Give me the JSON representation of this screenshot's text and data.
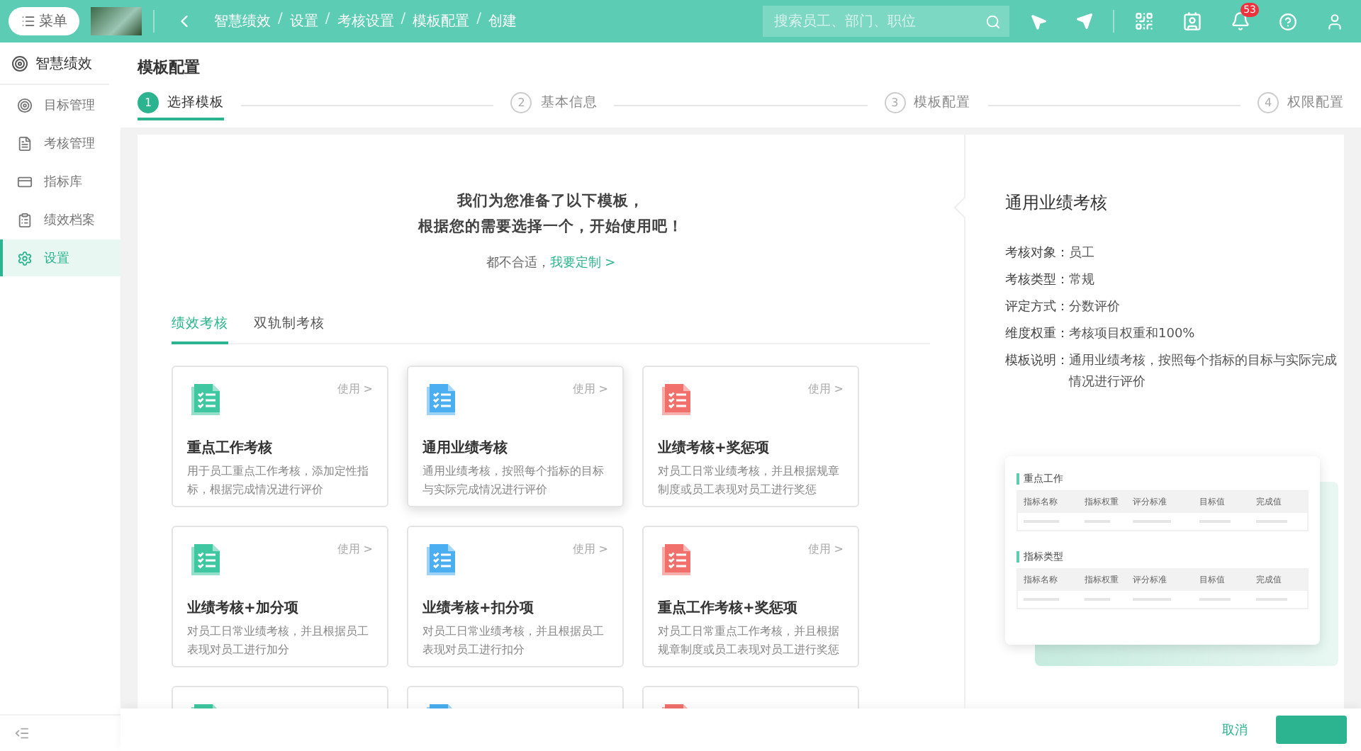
{
  "topbar": {
    "menu_button": "菜单",
    "breadcrumbs": [
      "智慧绩效",
      "设置",
      "考核设置",
      "模板配置",
      "创建"
    ],
    "breadcrumb_separator": "/",
    "search": {
      "placeholder": "搜索员工、部门、职位"
    },
    "notification_count": "53"
  },
  "sidebar": {
    "title": "智慧绩效",
    "items": [
      {
        "label": "目标管理",
        "kind": "target",
        "selected": false
      },
      {
        "label": "考核管理",
        "kind": "doc",
        "selected": false
      },
      {
        "label": "指标库",
        "kind": "card",
        "selected": false
      },
      {
        "label": "绩效档案",
        "kind": "clipboard",
        "selected": false
      },
      {
        "label": "设置",
        "kind": "gear",
        "selected": true
      }
    ]
  },
  "page_title": "模板配置",
  "steps": [
    {
      "number": "1",
      "label": "选择模板",
      "selected": true
    },
    {
      "number": "2",
      "label": "基本信息",
      "selected": false
    },
    {
      "number": "3",
      "label": "模板配置",
      "selected": false
    },
    {
      "number": "4",
      "label": "权限配置",
      "selected": false
    }
  ],
  "intro": [
    "我们为您准备了以下模板，",
    "根据您的需要选择一个，开始使用吧！"
  ],
  "custom_hint": {
    "text": "都不合适，",
    "link": "我要定制 >"
  },
  "tabs": [
    {
      "label": "绩效考核",
      "selected": true
    },
    {
      "label": "双轨制考核",
      "selected": false
    }
  ],
  "cards": [
    {
      "title": "重点工作考核",
      "description": "用于员工重点工作考核，添加定性指标，根据完成情况进行评价",
      "action": "使用 >",
      "color": "#3ec7a0",
      "selected": false
    },
    {
      "title": "通用业绩考核",
      "description": "通用业绩考核，按照每个指标的目标与实际完成情况进行评价",
      "action": "使用 >",
      "color": "#4aaef0",
      "selected": true
    },
    {
      "title": "业绩考核+奖惩项",
      "description": "对员工日常业绩考核，并且根据规章制度或员工表现对员工进行奖惩",
      "action": "使用 >",
      "color": "#f2706c",
      "selected": false
    },
    {
      "title": "业绩考核+加分项",
      "description": "对员工日常业绩考核，并且根据员工表现对员工进行加分",
      "action": "使用 >",
      "color": "#3ec7a0",
      "selected": false
    },
    {
      "title": "业绩考核+扣分项",
      "description": "对员工日常业绩考核，并且根据员工表现对员工进行扣分",
      "action": "使用 >",
      "color": "#4aaef0",
      "selected": false
    },
    {
      "title": "重点工作考核+奖惩项",
      "description": "对员工日常重点工作考核，并且根据规章制度或员工表现对员工进行奖惩",
      "action": "使用 >",
      "color": "#f2706c",
      "selected": false
    }
  ],
  "partial_cards": [
    {
      "color": "#3ec7a0"
    },
    {
      "color": "#4aaef0"
    },
    {
      "color": "#f2706c"
    }
  ],
  "detail": {
    "title": "通用业绩考核",
    "fields": [
      {
        "label": "考核对象：",
        "value": "员工"
      },
      {
        "label": "考核类型：",
        "value": "常规"
      },
      {
        "label": "评定方式：",
        "value": "分数评价"
      },
      {
        "label": "维度权重：",
        "value": "考核项目权重和100%"
      },
      {
        "label": "模板说明：",
        "value": "通用业绩考核，按照每个指标的目标与实际完成情况进行评价"
      }
    ]
  },
  "preview": {
    "sections": [
      {
        "title": "重点工作",
        "columns": [
          "指标名称",
          "指标权重",
          "评分标准",
          "目标值",
          "完成值"
        ]
      },
      {
        "title": "指标类型",
        "columns": [
          "指标名称",
          "指标权重",
          "评分标准",
          "目标值",
          "完成值"
        ]
      }
    ]
  },
  "footer": {
    "cancel": "取消"
  }
}
